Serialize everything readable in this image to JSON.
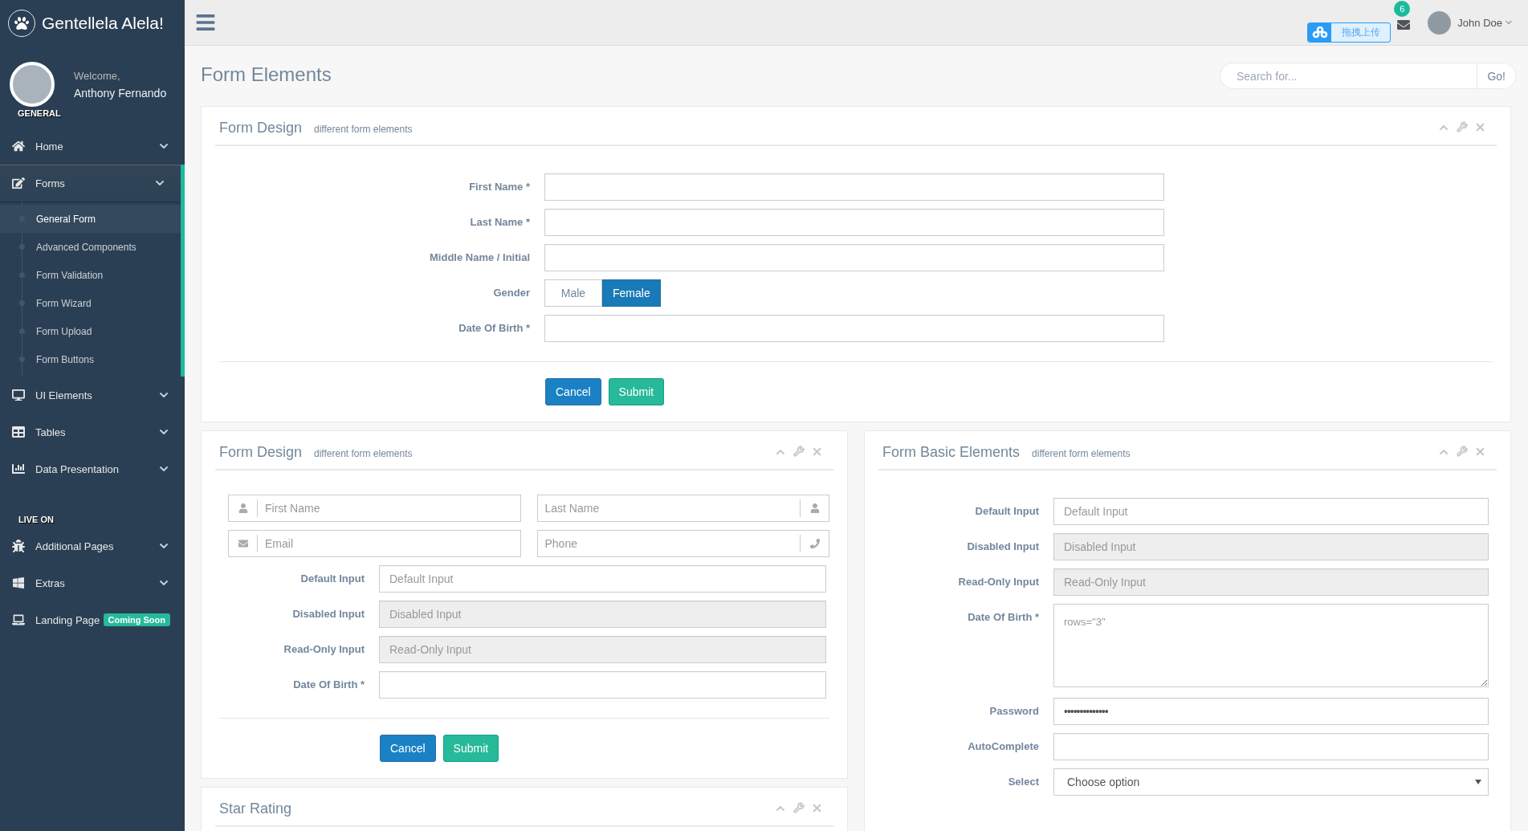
{
  "sidebar": {
    "brand": "Gentellela Alela!",
    "welcome": "Welcome,",
    "user_name": "Anthony Fernando",
    "sections": [
      {
        "title": "GENERAL",
        "items": [
          {
            "label": "Home",
            "collapsible": true,
            "selected": false
          },
          {
            "label": "Forms",
            "collapsible": true,
            "selected": true,
            "children": [
              {
                "label": "General Form",
                "selected": true
              },
              {
                "label": "Advanced Components",
                "selected": false
              },
              {
                "label": "Form Validation",
                "selected": false
              },
              {
                "label": "Form Wizard",
                "selected": false
              },
              {
                "label": "Form Upload",
                "selected": false
              },
              {
                "label": "Form Buttons",
                "selected": false
              }
            ]
          },
          {
            "label": "UI Elements",
            "collapsible": true,
            "selected": false
          },
          {
            "label": "Tables",
            "collapsible": true,
            "selected": false
          },
          {
            "label": "Data Presentation",
            "collapsible": true,
            "selected": false
          }
        ]
      },
      {
        "title": "LIVE ON",
        "items": [
          {
            "label": "Additional Pages",
            "collapsible": true,
            "selected": false
          },
          {
            "label": "Extras",
            "collapsible": true,
            "selected": false
          },
          {
            "label": "Landing Page",
            "collapsible": false,
            "selected": false,
            "badge": "Coming Soon"
          }
        ]
      }
    ]
  },
  "top_nav": {
    "mail_count": "6",
    "upload_widget": "拖拽上传",
    "user": "John Doe"
  },
  "page_title": "Form Elements",
  "search": {
    "placeholder": "Search for...",
    "button": "Go!"
  },
  "form_design_top": {
    "title": "Form Design",
    "subtitle": "different form elements",
    "fields": [
      {
        "kind": "text",
        "label": "First Name *"
      },
      {
        "kind": "text",
        "label": "Last Name *"
      },
      {
        "kind": "text",
        "label": "Middle Name / Initial"
      },
      {
        "kind": "toggle",
        "label": "Gender",
        "options": [
          {
            "label": "Male",
            "selected": false
          },
          {
            "label": "Female",
            "selected": true
          }
        ]
      },
      {
        "kind": "text",
        "label": "Date Of Birth *"
      }
    ],
    "buttons": [
      "Cancel",
      "Submit"
    ]
  },
  "form_design": {
    "title": "Form Design",
    "subtitle": "different form elements",
    "icon_inputs": [
      {
        "placeholder": "First Name"
      },
      {
        "placeholder": "Last Name"
      },
      {
        "placeholder": "Email"
      },
      {
        "placeholder": "Phone"
      }
    ],
    "fields": [
      {
        "kind": "input",
        "label": "Default Input",
        "placeholder": "Default Input"
      },
      {
        "kind": "disabled",
        "label": "Disabled Input",
        "placeholder": "Disabled Input"
      },
      {
        "kind": "readonly",
        "label": "Read-Only Input",
        "placeholder": "Read-Only Input"
      },
      {
        "kind": "input",
        "label": "Date Of Birth *"
      }
    ],
    "buttons": [
      "Cancel",
      "Submit"
    ]
  },
  "form_basic": {
    "title": "Form Basic Elements",
    "subtitle": "different form elements",
    "fields": [
      {
        "kind": "input",
        "label": "Default Input",
        "placeholder": "Default Input"
      },
      {
        "kind": "disabled",
        "label": "Disabled Input",
        "placeholder": "Disabled Input"
      },
      {
        "kind": "readonly",
        "label": "Read-Only Input",
        "placeholder": "Read-Only Input"
      },
      {
        "kind": "textarea",
        "label": "Date Of Birth *",
        "placeholder": "rows=\"3\""
      },
      {
        "kind": "password",
        "label": "Password",
        "value": "••••••••••••••"
      },
      {
        "kind": "input",
        "label": "AutoComplete"
      },
      {
        "kind": "select",
        "label": "Select",
        "value": "Choose option"
      }
    ]
  },
  "star_rating": {
    "title": "Star Rating"
  }
}
